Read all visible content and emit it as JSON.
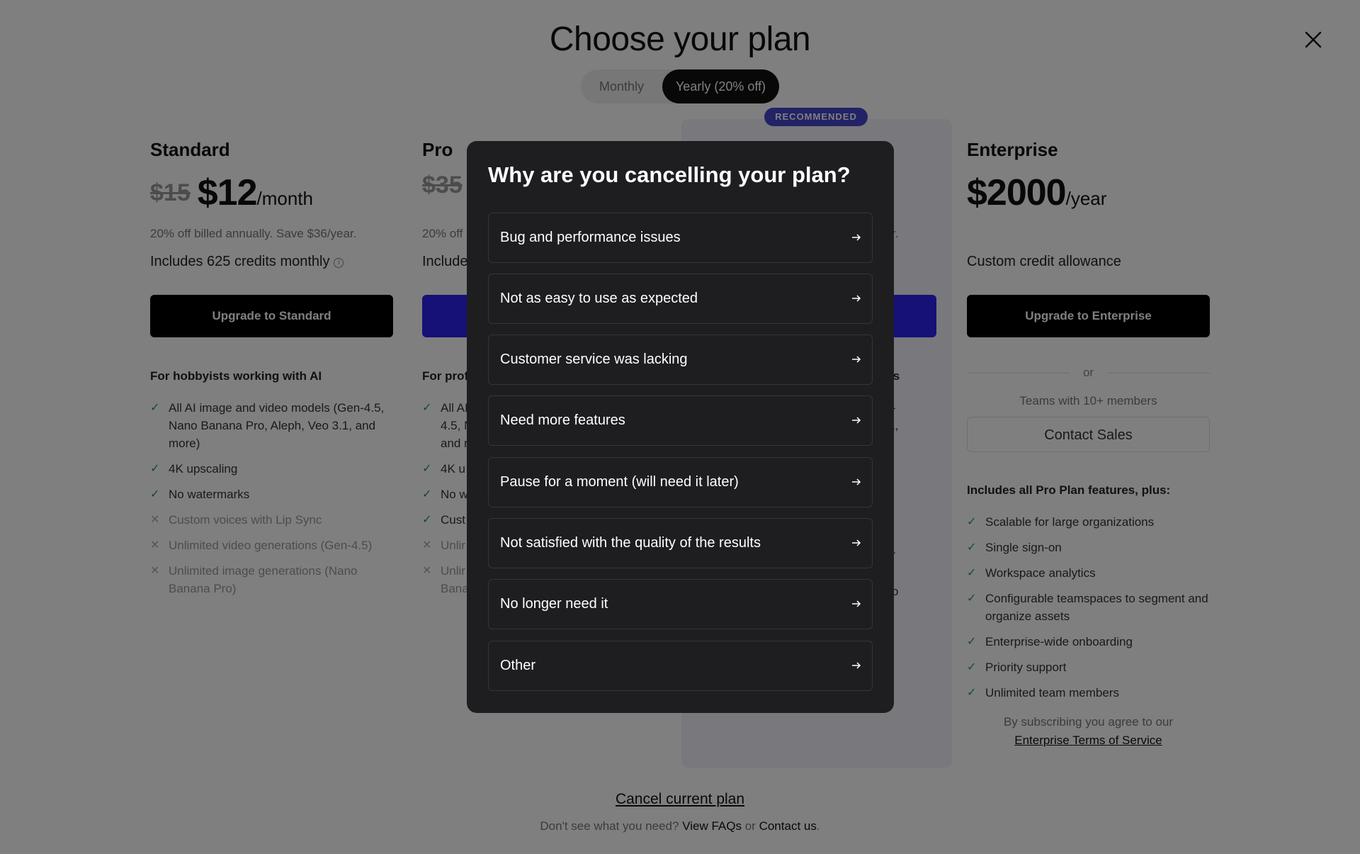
{
  "header": {
    "title": "Choose your plan",
    "billing_toggle": {
      "monthly": "Monthly",
      "yearly": "Yearly (20% off)",
      "selected": "yearly"
    }
  },
  "recommended_badge": "RECOMMENDED",
  "plans": {
    "standard": {
      "name": "Standard",
      "old_price": "$15",
      "price": "$12",
      "unit": "/month",
      "billing": "20% off billed annually. Save $36/year.",
      "credits": "Includes 625 credits monthly",
      "cta": "Upgrade to Standard",
      "for": "For hobbyists working with AI",
      "features": [
        {
          "text": "All AI image and video models (Gen-4.5, Nano Banana Pro, Aleph, Veo 3.1, and more)",
          "included": true
        },
        {
          "text": "4K upscaling",
          "included": true
        },
        {
          "text": "No watermarks",
          "included": true
        },
        {
          "text": "Custom voices with Lip Sync",
          "included": false
        },
        {
          "text": "Unlimited video generations (Gen-4.5)",
          "included": false
        },
        {
          "text": "Unlimited image generations (Nano Banana Pro)",
          "included": false
        }
      ]
    },
    "pro": {
      "name": "Pro",
      "old_price": "$35",
      "billing": "20% off",
      "credits": "Include",
      "for": "For prof",
      "features": [
        {
          "text": "All AI",
          "line2": "4.5, N",
          "line3": "and r",
          "included": true
        },
        {
          "text": "4K u",
          "included": true
        },
        {
          "text": "No w",
          "included": true
        },
        {
          "text": "Cust",
          "included": true
        },
        {
          "text": "Unlir",
          "included": false
        },
        {
          "text": "Unlir",
          "line2": "Bana",
          "included": false
        }
      ]
    },
    "unlimited_fragments": {
      "billing_tail": "ear.",
      "for_tail": "nits",
      "feature_1a": "en-",
      "feature_1b": "3.1,",
      "feature_5": "en-",
      "feature_6": "ano"
    },
    "enterprise": {
      "name": "Enterprise",
      "price": "$2000",
      "unit": "/year",
      "credits": "Custom credit allowance",
      "cta": "Upgrade to Enterprise",
      "or": "or",
      "teams": "Teams with 10+ members",
      "contact_sales": "Contact Sales",
      "includes": "Includes all Pro Plan features, plus:",
      "features": [
        "Scalable for large organizations",
        "Single sign-on",
        "Workspace analytics",
        "Configurable teamspaces to segment and organize assets",
        "Enterprise-wide onboarding",
        "Priority support",
        "Unlimited team members"
      ],
      "terms_prefix": "By subscribing you agree to our",
      "terms_link": "Enterprise Terms of Service"
    }
  },
  "footer": {
    "cancel": "Cancel current plan",
    "prefix": "Don't see what you need?",
    "faq": "View FAQs",
    "or": "or",
    "contact": "Contact us",
    "period": "."
  },
  "modal": {
    "title": "Why are you cancelling your plan?",
    "reasons": [
      "Bug and performance issues",
      "Not as easy to use as expected",
      "Customer service was lacking",
      "Need more features",
      "Pause for a moment (will need it later)",
      "Not satisfied with the quality of the results",
      "No longer need it",
      "Other"
    ]
  },
  "colors": {
    "accent_blue": "#2a22ee",
    "badge_purple": "#4444cc",
    "check_green": "#2a9a4a",
    "modal_bg": "#1e1e21"
  },
  "icons": [
    "close-icon",
    "info-icon",
    "check-icon",
    "x-icon",
    "arrow-right-icon"
  ]
}
